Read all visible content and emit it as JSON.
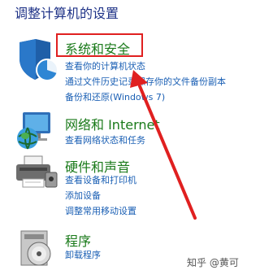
{
  "header": {
    "title": "调整计算机的设置"
  },
  "categories": [
    {
      "title": "系统和安全",
      "links": [
        "查看你的计算机状态",
        "通过文件历史记录保存你的文件备份副本",
        "备份和还原(Windows 7)"
      ],
      "icon": "shield-icon"
    },
    {
      "title": "网络和 Internet",
      "links": [
        "查看网络状态和任务"
      ],
      "icon": "network-globe-icon"
    },
    {
      "title": "硬件和声音",
      "links": [
        "查看设备和打印机",
        "添加设备",
        "调整常用移动设置"
      ],
      "icon": "printer-icon"
    },
    {
      "title": "程序",
      "links": [
        "卸载程序"
      ],
      "icon": "programs-disc-icon"
    }
  ],
  "annotation": {
    "highlight": "红框",
    "arrow": "红色箭头"
  },
  "watermark": "知乎 @黄可",
  "colors": {
    "accent_red": "#e02020",
    "link": "#1a5fb4",
    "category": "#1a7a1a",
    "title": "#1e3287"
  }
}
